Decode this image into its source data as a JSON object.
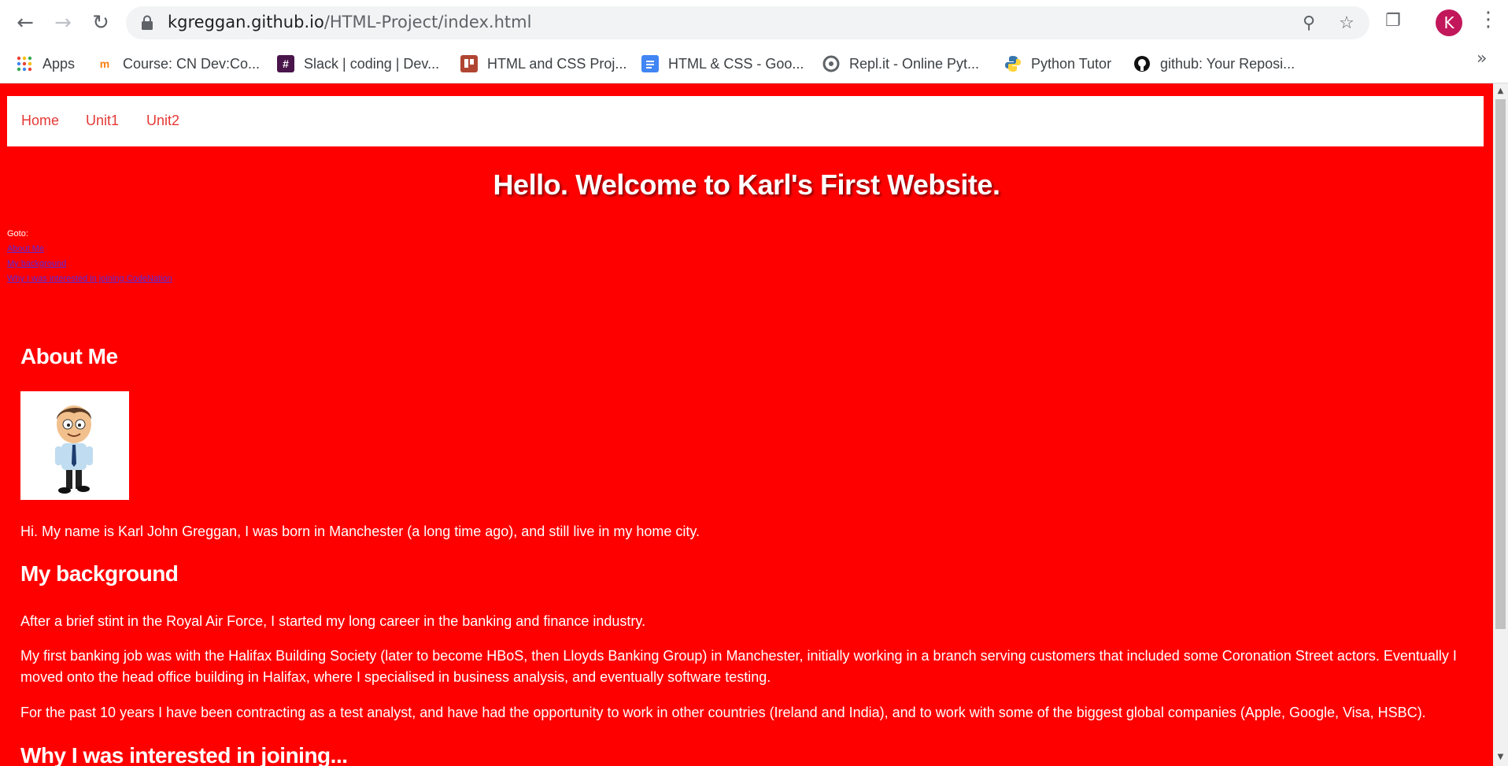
{
  "browser": {
    "url_host": "kgreggan.github.io",
    "url_path": "/HTML-Project/index.html",
    "profile_initial": "K",
    "bookmarks": [
      {
        "label": "Apps",
        "icon": "apps-grid-icon"
      },
      {
        "label": "Course: CN Dev:Co...",
        "icon": "moodle-icon"
      },
      {
        "label": "Slack | coding | Dev...",
        "icon": "slack-icon"
      },
      {
        "label": "HTML and CSS Proj...",
        "icon": "trello-icon"
      },
      {
        "label": "HTML & CSS - Goo...",
        "icon": "google-docs-icon"
      },
      {
        "label": "Repl.it - Online Pyt...",
        "icon": "replit-icon"
      },
      {
        "label": "Python Tutor",
        "icon": "python-icon"
      },
      {
        "label": "github: Your Reposi...",
        "icon": "github-icon"
      }
    ],
    "bookmarks_overflow": "»"
  },
  "page": {
    "nav": [
      "Home",
      "Unit1",
      "Unit2"
    ],
    "hero": "Hello. Welcome to Karl's First Website.",
    "goto_label": "Goto:",
    "goto_links": [
      "About Me",
      "My background",
      "Why I was interested in joining CodeNation"
    ],
    "about_heading": "About Me",
    "about_text": "Hi. My name is Karl John Greggan, I was born in Manchester (a long time ago), and still live in my home city.",
    "background_heading": "My background",
    "background_p1": "After a brief stint in the Royal Air Force, I started my long career in the banking and finance industry.",
    "background_p2": "My first banking job was with the Halifax Building Society (later to become HBoS, then Lloyds Banking Group) in Manchester, initially working in a branch serving customers that included some Coronation Street actors. Eventually I moved onto the head office building in Halifax, where I specialised in business analysis, and eventually software testing.",
    "background_p3": "For the past 10 years I have been contracting as a test analyst, and have had the opportunity to work in other countries (Ireland and India), and to work with some of the biggest global companies (Apple, Google, Visa, HSBC).",
    "why_heading": "Why I was interested in joining..."
  },
  "colors": {
    "page_bg": "#ff0000",
    "nav_link": "#e53935",
    "goto_link": "#5b2bd9"
  }
}
